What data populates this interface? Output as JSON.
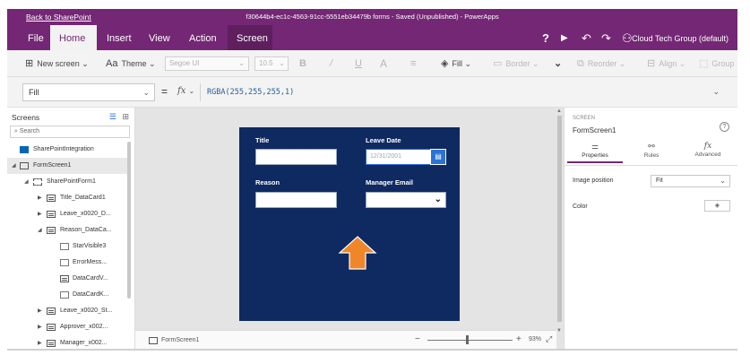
{
  "titlebar": {
    "back_link": "Back to SharePoint",
    "document": "f30644b4-ec1c-4563-91cc-5551eb34479b forms - Saved (Unpublished) - PowerApps"
  },
  "menubar": {
    "tabs": [
      "File",
      "Home",
      "Insert",
      "View",
      "Action",
      "Screen"
    ],
    "active_tab": "Home",
    "highlighted_tab": "Screen",
    "icons": [
      "help-icon",
      "play-icon",
      "undo-icon",
      "redo-icon",
      "user-icon"
    ],
    "help_glyph": "?",
    "play_glyph": "▶",
    "undo_glyph": "↶",
    "redo_glyph": "↷",
    "user_glyph": "⚇",
    "account": "Cloud Tech Group (default)"
  },
  "ribbon": {
    "new_screen": "New screen",
    "theme": "Theme",
    "font": "Segoe UI",
    "font_size": "10.5",
    "bold": "B",
    "italic": "/",
    "underline": "U",
    "font_color": "A",
    "align": "≡",
    "fill": "Fill",
    "border": "Border",
    "reorder": "Reorder",
    "align_label": "Align",
    "group": "Group"
  },
  "formula": {
    "property": "Fill",
    "equals": "=",
    "fx": "fx",
    "expression": "RGBA(255,255,255,1)"
  },
  "screens_panel": {
    "title": "Screens",
    "search_placeholder": "Search",
    "tree": [
      {
        "label": "SharePointIntegration",
        "icon": "sharepoint-icon",
        "indent": 0
      },
      {
        "label": "FormScreen1",
        "icon": "screen-icon",
        "indent": 0
      },
      {
        "label": "SharePointForm1",
        "icon": "form-icon",
        "indent": 1
      },
      {
        "label": "Title_DataCard1",
        "icon": "card-icon",
        "indent": 2
      },
      {
        "label": "Leave_x0020_D...",
        "icon": "card-icon",
        "indent": 2
      },
      {
        "label": "Reason_DataCa...",
        "icon": "card-icon",
        "indent": 2
      },
      {
        "label": "StarVisible3",
        "icon": "text-icon",
        "indent": 3
      },
      {
        "label": "ErrorMess...",
        "icon": "text-icon",
        "indent": 3
      },
      {
        "label": "DataCardV...",
        "icon": "input-icon",
        "indent": 3
      },
      {
        "label": "DataCardK...",
        "icon": "text-icon",
        "indent": 3
      },
      {
        "label": "Leave_x0020_St...",
        "icon": "card-icon",
        "indent": 2
      },
      {
        "label": "Approver_x002...",
        "icon": "card-icon",
        "indent": 2
      },
      {
        "label": "Manager_x002...",
        "icon": "card-icon",
        "indent": 2
      }
    ]
  },
  "form": {
    "title_label": "Title",
    "leave_date_label": "Leave Date",
    "date_placeholder": "12/31/2001",
    "reason_label": "Reason",
    "manager_email_label": "Manager Email",
    "background_color": "#0e2a61",
    "arrow_color": "#f0862a"
  },
  "canvas_footer": {
    "screen_name": "FormScreen1",
    "zoom_minus": "−",
    "zoom_plus": "+",
    "zoom": "93%"
  },
  "properties_panel": {
    "section_label": "SCREEN",
    "name": "FormScreen1",
    "help": "?",
    "tabs": [
      "Properties",
      "Rules",
      "Advanced"
    ],
    "active_tab": "Properties",
    "image_position_label": "Image position",
    "image_position_value": "Fit",
    "color_label": "Color"
  }
}
